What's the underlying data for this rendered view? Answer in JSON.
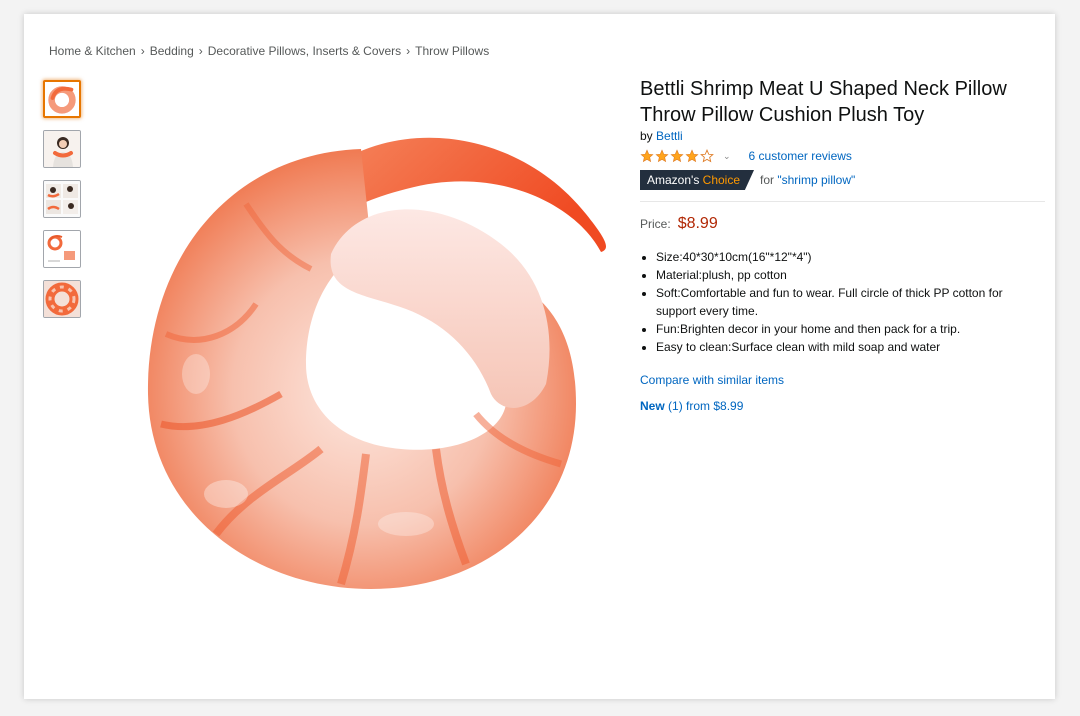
{
  "breadcrumb": [
    "Home & Kitchen",
    "Bedding",
    "Decorative Pillows, Inserts & Covers",
    "Throw Pillows"
  ],
  "breadcrumb_separator": "›",
  "thumbnails": [
    {
      "icon": "shrimp-pillow-thumbnail",
      "selected": true
    },
    {
      "icon": "woman-with-pillow-thumbnail",
      "selected": false
    },
    {
      "icon": "pillow-usage-collage-thumbnail",
      "selected": false
    },
    {
      "icon": "pillow-dimensions-thumbnail",
      "selected": false
    },
    {
      "icon": "shrimp-closeup-thumbnail",
      "selected": false
    }
  ],
  "product": {
    "title": "Bettli Shrimp Meat U Shaped Neck Pillow Throw Pillow Cushion Plush Toy",
    "by_prefix": "by",
    "brand": "Bettli",
    "rating": 4,
    "rating_max": 5,
    "reviews_label": "6 customer reviews",
    "badge_prefix": "Amazon's",
    "badge_accent": "Choice",
    "for_prefix": "for",
    "for_keyword": "\"shrimp pillow\"",
    "price_label": "Price:",
    "price": "$8.99",
    "bullets": [
      "Size:40*30*10cm(16\"*12\"*4\")",
      "Material:plush, pp cotton",
      "Soft:Comfortable and fun to wear. Full circle of thick PP cotton for support every time.",
      "Fun:Brighten decor in your home and then pack for a trip.",
      "Easy to clean:Surface clean with mild soap and water"
    ],
    "compare_label": "Compare with similar items",
    "offers_new": "New",
    "offers_rest": "(1) from $8.99"
  },
  "colors": {
    "link": "#0066c0",
    "price": "#b12704",
    "badge_bg": "#232f3e",
    "badge_accent": "#ff9900",
    "star": "#ffa41c",
    "shrimp_orange": "#f26a3c",
    "shrimp_pale": "#f8d3c8"
  }
}
